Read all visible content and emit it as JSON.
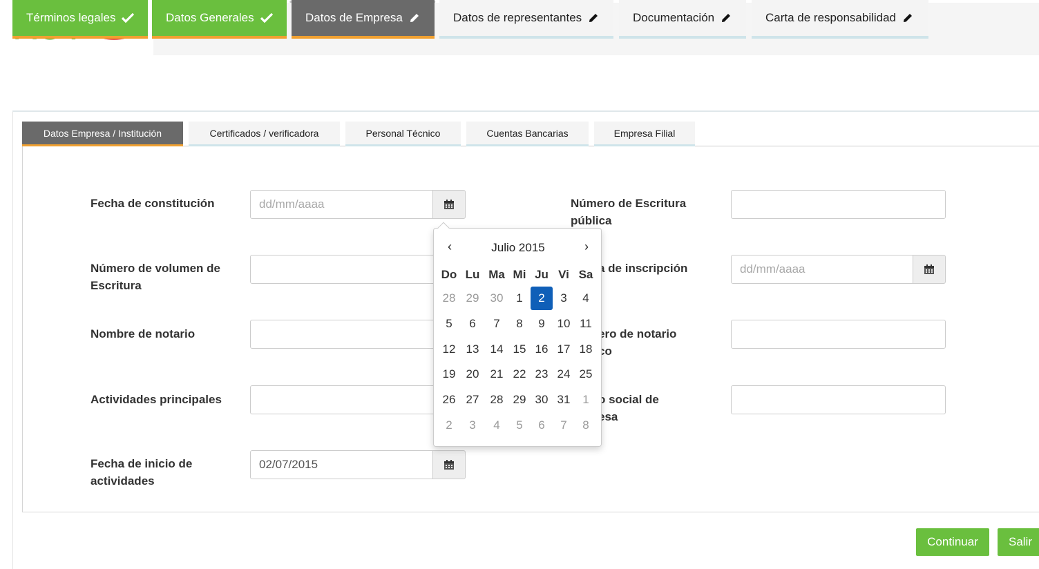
{
  "logo": {
    "text": "RUV"
  },
  "main_tabs": [
    {
      "label": "Términos legales",
      "state": "done",
      "icon": "check-icon"
    },
    {
      "label": "Datos Generales",
      "state": "done",
      "icon": "check-icon"
    },
    {
      "label": "Datos de Empresa",
      "state": "active",
      "icon": "pencil-icon"
    },
    {
      "label": "Datos de representantes",
      "state": "todo",
      "icon": "pencil-icon"
    },
    {
      "label": "Documentación",
      "state": "todo",
      "icon": "pencil-icon"
    },
    {
      "label": "Carta de responsabilidad",
      "state": "todo",
      "icon": "pencil-icon"
    }
  ],
  "sub_tabs": [
    {
      "label": "Datos Empresa / Institución",
      "state": "active"
    },
    {
      "label": "Certificados / verificadora",
      "state": "todo"
    },
    {
      "label": "Personal Técnico",
      "state": "todo"
    },
    {
      "label": "Cuentas Bancarias",
      "state": "todo"
    },
    {
      "label": "Empresa Filial",
      "state": "todo"
    }
  ],
  "form": {
    "fecha_constitucion": {
      "label": "Fecha de constitución",
      "value": "",
      "placeholder": "dd/mm/aaaa"
    },
    "numero_volumen": {
      "label_line1": "Número de volumen de",
      "label_line2": "Escritura",
      "value": ""
    },
    "nombre_notario": {
      "label": "Nombre de notario",
      "value": ""
    },
    "actividades": {
      "label": "Actividades principales",
      "value": ""
    },
    "fecha_inicio": {
      "label_line1": "Fecha de inicio de",
      "label_line2": "actividades",
      "value": "02/07/2015"
    },
    "numero_escritura": {
      "label_line1": "Número de Escritura",
      "label_line2": "pública",
      "value": ""
    },
    "fecha_inscripcion": {
      "label_visible": "a de inscripción",
      "value": "",
      "placeholder": "dd/mm/aaaa"
    },
    "numero_notario": {
      "label_line1_visible": "ero de notario",
      "label_line2_visible": "co",
      "value": ""
    },
    "objeto_social": {
      "label_line1_visible": "o social de",
      "label_line2_visible": "esa",
      "value": ""
    }
  },
  "datepicker": {
    "title": "Julio 2015",
    "prev": "‹",
    "next": "›",
    "days_of_week": [
      "Do",
      "Lu",
      "Ma",
      "Mi",
      "Ju",
      "Vi",
      "Sa"
    ],
    "weeks": [
      [
        {
          "d": "28",
          "old": true
        },
        {
          "d": "29",
          "old": true
        },
        {
          "d": "30",
          "old": true
        },
        {
          "d": "1"
        },
        {
          "d": "2",
          "sel": true
        },
        {
          "d": "3"
        },
        {
          "d": "4"
        }
      ],
      [
        {
          "d": "5"
        },
        {
          "d": "6"
        },
        {
          "d": "7"
        },
        {
          "d": "8"
        },
        {
          "d": "9"
        },
        {
          "d": "10"
        },
        {
          "d": "11"
        }
      ],
      [
        {
          "d": "12"
        },
        {
          "d": "13"
        },
        {
          "d": "14"
        },
        {
          "d": "15"
        },
        {
          "d": "16"
        },
        {
          "d": "17"
        },
        {
          "d": "18"
        }
      ],
      [
        {
          "d": "19"
        },
        {
          "d": "20"
        },
        {
          "d": "21"
        },
        {
          "d": "22"
        },
        {
          "d": "23"
        },
        {
          "d": "24"
        },
        {
          "d": "25"
        }
      ],
      [
        {
          "d": "26"
        },
        {
          "d": "27"
        },
        {
          "d": "28"
        },
        {
          "d": "29"
        },
        {
          "d": "30"
        },
        {
          "d": "31"
        },
        {
          "d": "1",
          "old": true
        }
      ],
      [
        {
          "d": "2",
          "old": true
        },
        {
          "d": "3",
          "old": true
        },
        {
          "d": "4",
          "old": true
        },
        {
          "d": "5",
          "old": true
        },
        {
          "d": "6",
          "old": true
        },
        {
          "d": "7",
          "old": true
        },
        {
          "d": "8",
          "old": true
        }
      ]
    ]
  },
  "buttons": {
    "continue": "Continuar",
    "exit": "Salir"
  },
  "colors": {
    "brand_green": "#6abf3e",
    "active_tab": "#6a6a6a",
    "accent_orange": "#f0a030",
    "selected_day": "#0f5fb8"
  }
}
